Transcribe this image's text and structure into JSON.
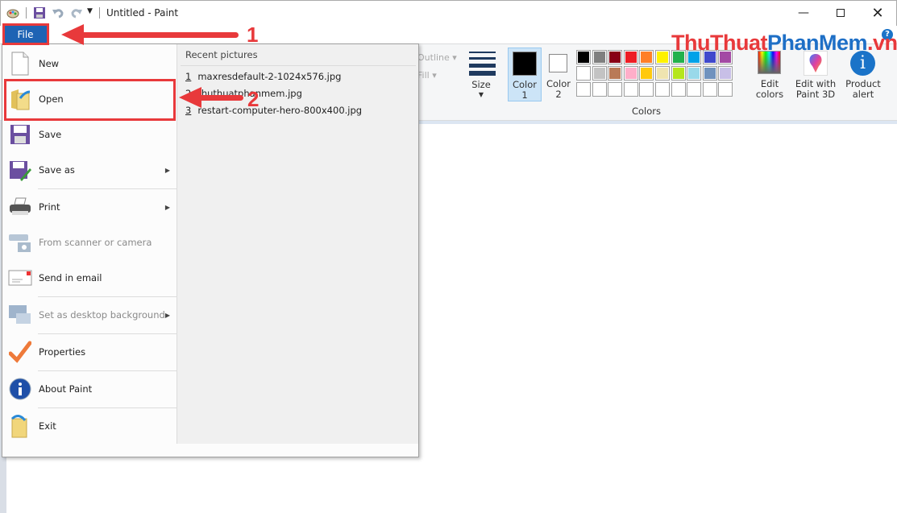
{
  "window": {
    "title": "Untitled - Paint",
    "minimize_icon": "minimize-icon",
    "maximize_icon": "maximize-icon",
    "close_icon": "close-icon"
  },
  "quick_access": {
    "icons": [
      "paint-app-icon",
      "save-icon",
      "undo-icon",
      "redo-icon",
      "customize-dropdown-icon"
    ]
  },
  "file_tab": {
    "label": "File"
  },
  "file_menu": {
    "items": [
      {
        "label": "New",
        "icon": "new-document-icon",
        "enabled": true,
        "submenu": false
      },
      {
        "label": "Open",
        "icon": "open-folder-icon",
        "enabled": true,
        "submenu": false
      },
      {
        "label": "Save",
        "icon": "save-floppy-icon",
        "enabled": true,
        "submenu": false
      },
      {
        "label": "Save as",
        "icon": "save-as-icon",
        "enabled": true,
        "submenu": true
      },
      {
        "label": "Print",
        "icon": "printer-icon",
        "enabled": true,
        "submenu": true
      },
      {
        "label": "From scanner or camera",
        "icon": "scanner-icon",
        "enabled": false,
        "submenu": false
      },
      {
        "label": "Send in email",
        "icon": "email-icon",
        "enabled": true,
        "submenu": false
      },
      {
        "label": "Set as desktop background",
        "icon": "desktop-icon",
        "enabled": false,
        "submenu": true
      },
      {
        "label": "Properties",
        "icon": "checkmark-icon",
        "enabled": true,
        "submenu": false
      },
      {
        "label": "About Paint",
        "icon": "info-icon",
        "enabled": true,
        "submenu": false
      },
      {
        "label": "Exit",
        "icon": "exit-icon",
        "enabled": true,
        "submenu": false
      }
    ],
    "recent_title": "Recent pictures",
    "recent": [
      {
        "num": "1",
        "name": "maxresdefault-2-1024x576.jpg"
      },
      {
        "num": "2",
        "name": "thuthuatphanmem.jpg"
      },
      {
        "num": "3",
        "name": "restart-computer-hero-800x400.jpg"
      }
    ]
  },
  "ribbon": {
    "outline_label": "Outline",
    "fill_label": "Fill",
    "size_label": "Size",
    "color1_label": "Color 1",
    "color1_value": "#000000",
    "color2_label": "Color 2",
    "color2_value": "#ffffff",
    "colors_group_label": "Colors",
    "palette": [
      [
        "#000000",
        "#7f7f7f",
        "#880015",
        "#ed1c24",
        "#ff7f27",
        "#fff200",
        "#22b14c",
        "#00a2e8",
        "#3f48cc",
        "#a349a4"
      ],
      [
        "#ffffff",
        "#c3c3c3",
        "#b97a57",
        "#ffaec9",
        "#ffc90e",
        "#efe4b0",
        "#b5e61d",
        "#99d9ea",
        "#7092be",
        "#c8bfe7"
      ]
    ],
    "edit_colors_label": "Edit colors",
    "paint3d_label": "Edit with Paint 3D",
    "product_alert_label": "Product alert",
    "help_icon": "help-icon"
  },
  "annotations": {
    "step1": "1",
    "step2": "2",
    "color": "#e8393b"
  },
  "watermark": {
    "part1": "ThuThuat",
    "part2": "PhanMem",
    "part3": ".vn",
    "color1": "#e8393b",
    "color2": "#1e6fc6"
  }
}
